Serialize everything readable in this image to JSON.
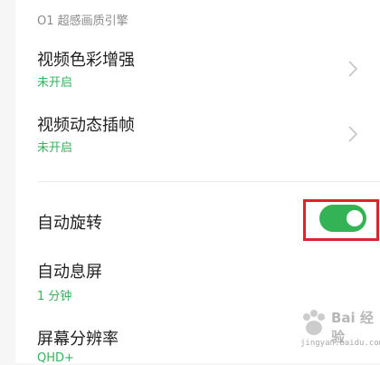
{
  "section": {
    "header": "O1 超感画质引擎"
  },
  "rows": [
    {
      "title": "视频色彩增强",
      "subtitle": "未开启"
    },
    {
      "title": "视频动态插帧",
      "subtitle": "未开启"
    },
    {
      "title": "自动旋转",
      "toggle_on": true
    },
    {
      "title": "自动息屏",
      "subtitle": "1 分钟"
    },
    {
      "title": "屏幕分辨率",
      "subtitle": "QHD+"
    }
  ],
  "colors": {
    "accent_green": "#36b25a",
    "switch_on": "#33b356",
    "highlight_box": "#e0222c"
  },
  "watermark": {
    "brand": "Bai 经验",
    "url": "jingyan.baidu.com"
  }
}
